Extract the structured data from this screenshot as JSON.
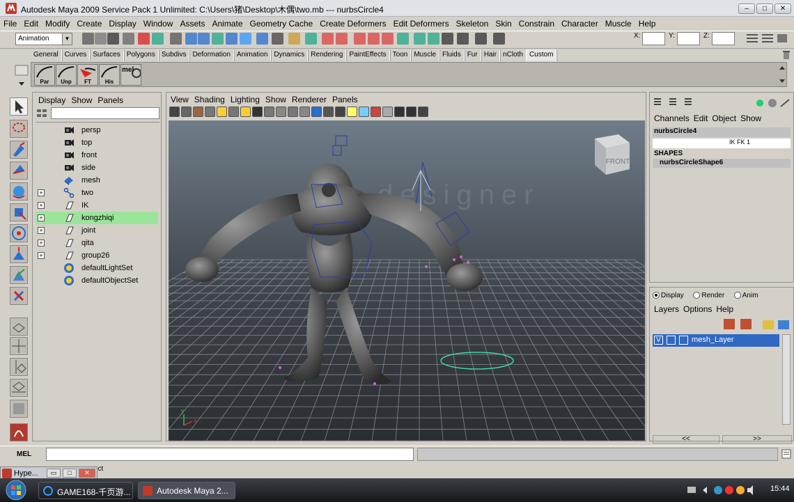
{
  "window": {
    "title": "Autodesk Maya 2009 Service Pack 1 Unlimited: C:\\Users\\猪\\Desktop\\木偶\\two.mb    ---    nurbsCircle4",
    "controls": [
      "minimize-button",
      "maximize-button",
      "close-button"
    ]
  },
  "menubar": {
    "items": [
      "File",
      "Edit",
      "Modify",
      "Create",
      "Display",
      "Window",
      "Assets",
      "Animate",
      "Geometry Cache",
      "Create Deformers",
      "Edit Deformers",
      "Skeleton",
      "Skin",
      "Constrain",
      "Character",
      "Muscle",
      "Help"
    ]
  },
  "statusline": {
    "menuset": "Animation",
    "x_label": "X:",
    "y_label": "Y:",
    "z_label": "Z:",
    "x_value": "",
    "y_value": "",
    "z_value": ""
  },
  "shelf": {
    "tabs": [
      "General",
      "Curves",
      "Surfaces",
      "Polygons",
      "Subdivs",
      "Deformation",
      "Animation",
      "Dynamics",
      "Rendering",
      "PaintEffects",
      "Toon",
      "Muscle",
      "Fluids",
      "Fur",
      "Hair",
      "nCloth",
      "Custom"
    ],
    "selected_tab": "Custom",
    "buttons": [
      {
        "label": "Par",
        "icon": "curve-icon"
      },
      {
        "label": "Unp",
        "icon": "curve-icon"
      },
      {
        "label": "FT",
        "icon": "curve-red-icon"
      },
      {
        "label": "His",
        "icon": "curve-icon"
      },
      {
        "label": "mel",
        "icon": "mel-script-icon"
      }
    ]
  },
  "outliner": {
    "menu": [
      "Display",
      "Show",
      "Panels"
    ],
    "filter": "",
    "items": [
      {
        "label": "persp",
        "icon": "camera-icon",
        "expandable": false,
        "selected": false
      },
      {
        "label": "top",
        "icon": "camera-icon",
        "expandable": false,
        "selected": false
      },
      {
        "label": "front",
        "icon": "camera-icon",
        "expandable": false,
        "selected": false
      },
      {
        "label": "side",
        "icon": "camera-icon",
        "expandable": false,
        "selected": false
      },
      {
        "label": "mesh",
        "icon": "mesh-icon",
        "expandable": false,
        "selected": false
      },
      {
        "label": "two",
        "icon": "joint-icon",
        "expandable": true,
        "selected": false
      },
      {
        "label": "IK",
        "icon": "group-icon",
        "expandable": true,
        "selected": false
      },
      {
        "label": "kongzhiqi",
        "icon": "group-icon",
        "expandable": true,
        "selected": true
      },
      {
        "label": "joint",
        "icon": "group-icon",
        "expandable": true,
        "selected": false
      },
      {
        "label": "qita",
        "icon": "group-icon",
        "expandable": true,
        "selected": false
      },
      {
        "label": "group26",
        "icon": "group-icon",
        "expandable": true,
        "selected": false
      },
      {
        "label": "defaultLightSet",
        "icon": "set-icon",
        "expandable": false,
        "selected": false
      },
      {
        "label": "defaultObjectSet",
        "icon": "set-icon",
        "expandable": false,
        "selected": false
      }
    ]
  },
  "viewport": {
    "menu": [
      "View",
      "Shading",
      "Lighting",
      "Show",
      "Renderer",
      "Panels"
    ],
    "viewcube_label": "FRONT",
    "watermark": "designer",
    "axis_y": "y",
    "axis_x": "x"
  },
  "channelbox": {
    "menu": [
      "Channels",
      "Edit",
      "Object",
      "Show"
    ],
    "node": "nurbsCircle4",
    "attribute": "IK FK  1",
    "shapes_header": "SHAPES",
    "shape": "nurbsCircleShape6"
  },
  "layers": {
    "modes": [
      "Display",
      "Render",
      "Anim"
    ],
    "selected_mode": "Display",
    "menu": [
      "Layers",
      "Options",
      "Help"
    ],
    "layer_visible": "V",
    "layer_name": "mesh_Layer",
    "nav_prev": "<<",
    "nav_next": ">>"
  },
  "commandline": {
    "label": "MEL",
    "value": ""
  },
  "helpline": {
    "text": "ect"
  },
  "hypergraph_mini": {
    "title": "Hype..."
  },
  "taskbar": {
    "items": [
      "GAME168-千页游...",
      "Autodesk Maya 2..."
    ],
    "clock": "15:44"
  },
  "colors": {
    "outliner_selected": "#9be59b",
    "layer_selected": "#3168c2",
    "viewport_top": "#6f7d89",
    "viewport_bottom": "#2a2d31"
  }
}
